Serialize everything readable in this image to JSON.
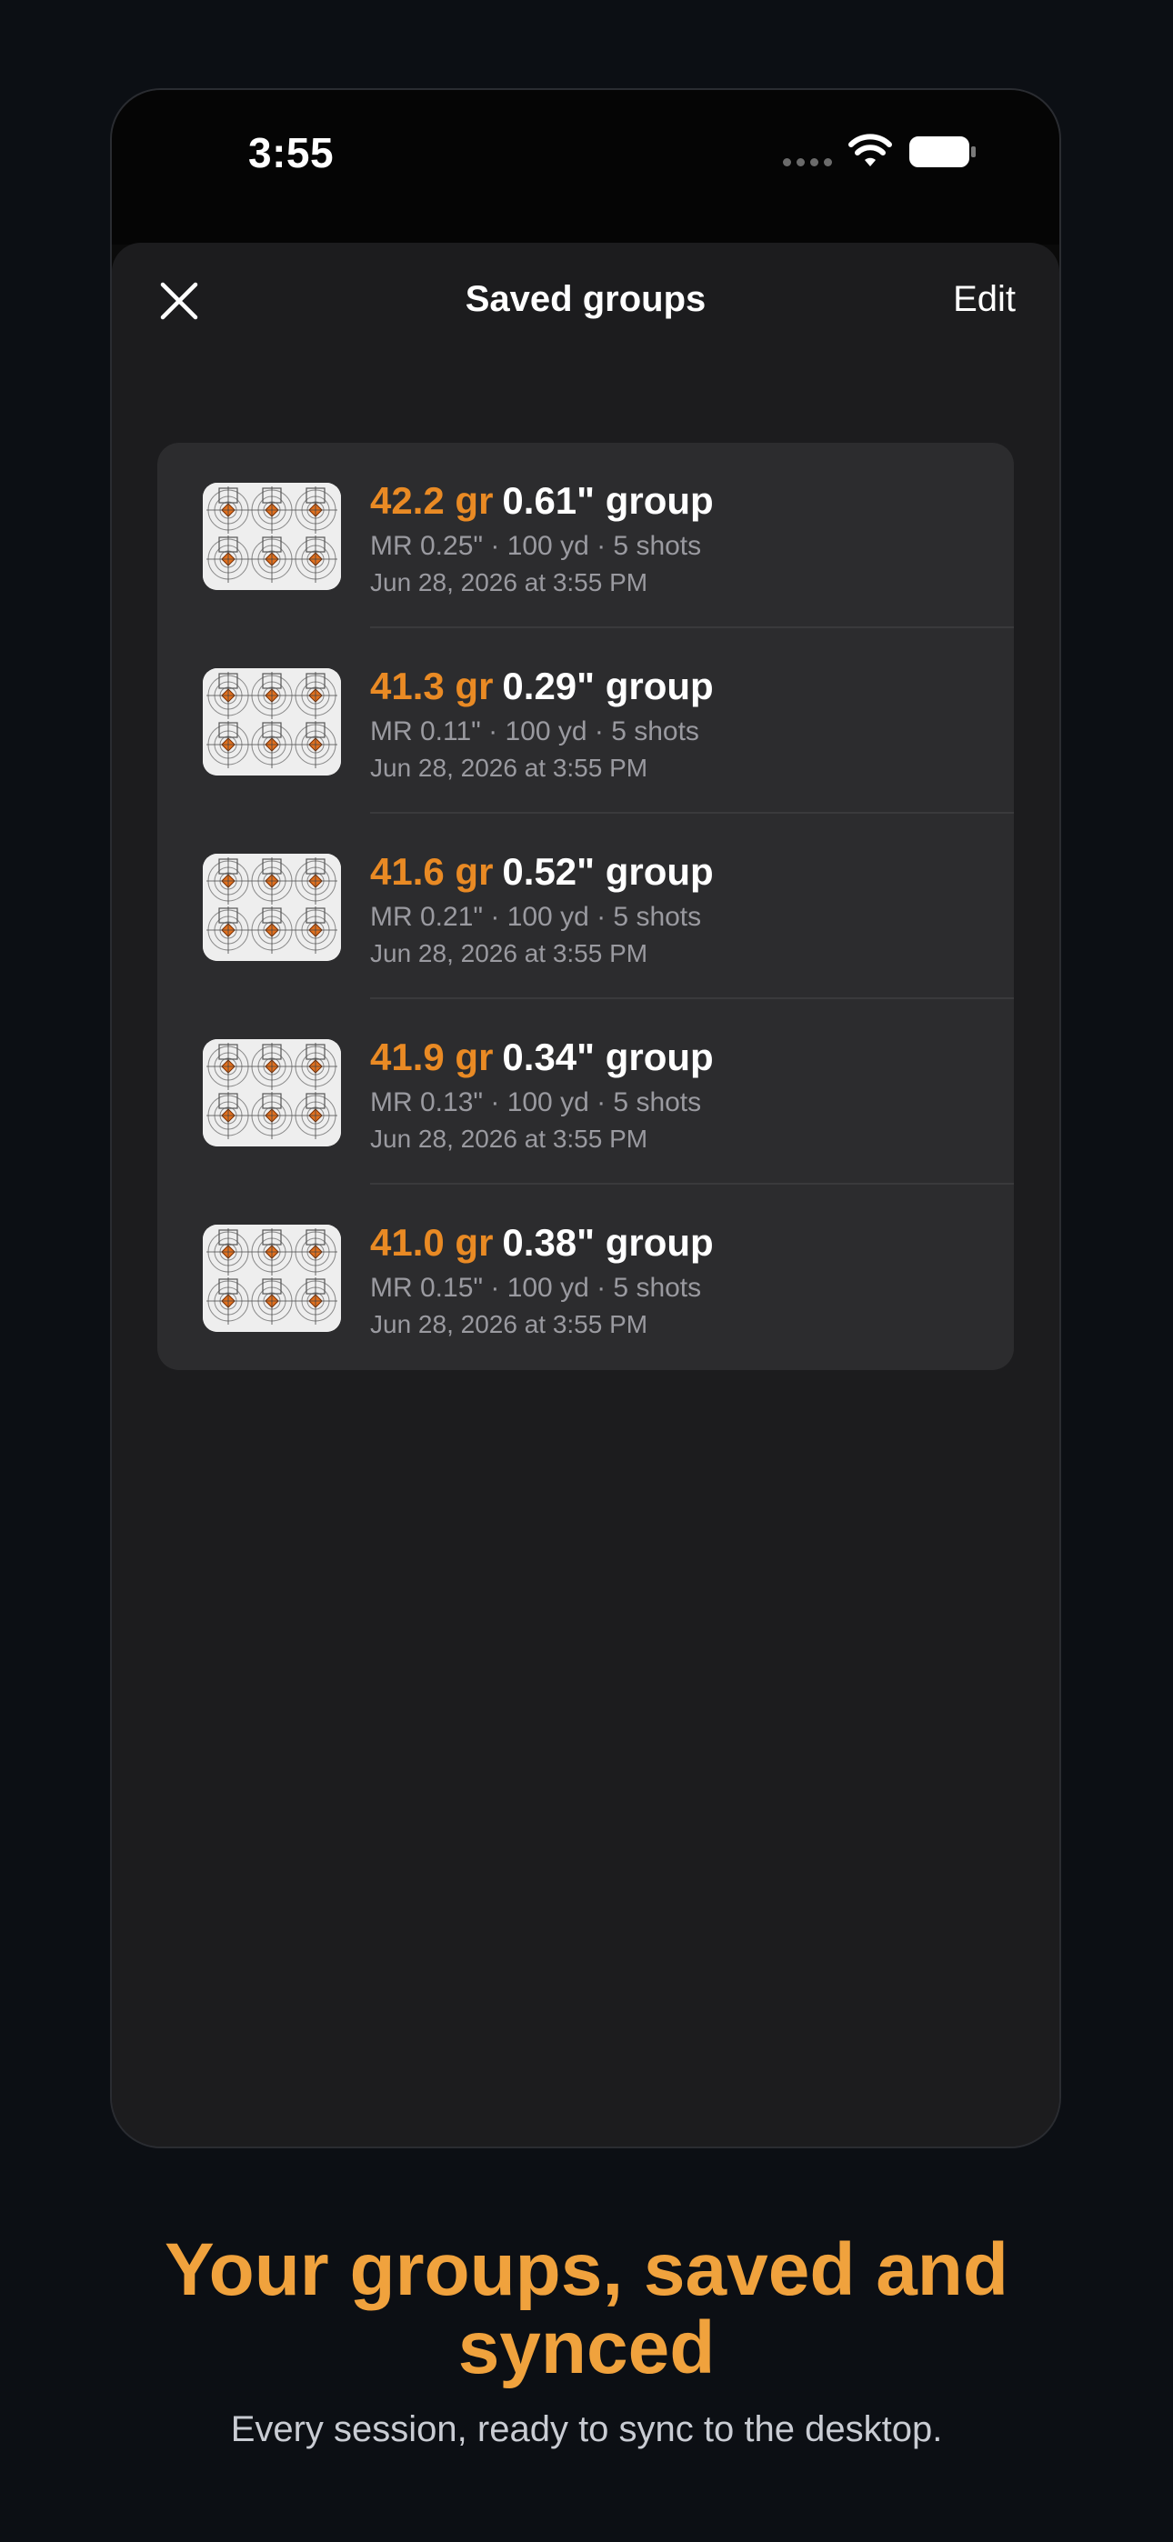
{
  "status_bar": {
    "time": "3:55"
  },
  "sheet": {
    "title": "Saved groups",
    "edit_label": "Edit",
    "close_icon": "close-icon"
  },
  "groups": [
    {
      "charge": "42.2 gr",
      "group": "0.61\" group",
      "meta": "MR 0.25\" · 100 yd · 5 shots",
      "date": "Jun 28, 2026 at 3:55 PM"
    },
    {
      "charge": "41.3 gr",
      "group": "0.29\" group",
      "meta": "MR 0.11\" · 100 yd · 5 shots",
      "date": "Jun 28, 2026 at 3:55 PM"
    },
    {
      "charge": "41.6 gr",
      "group": "0.52\" group",
      "meta": "MR 0.21\" · 100 yd · 5 shots",
      "date": "Jun 28, 2026 at 3:55 PM"
    },
    {
      "charge": "41.9 gr",
      "group": "0.34\" group",
      "meta": "MR 0.13\" · 100 yd · 5 shots",
      "date": "Jun 28, 2026 at 3:55 PM"
    },
    {
      "charge": "41.0 gr",
      "group": "0.38\" group",
      "meta": "MR 0.15\" · 100 yd · 5 shots",
      "date": "Jun 28, 2026 at 3:55 PM"
    }
  ],
  "marketing": {
    "headline": "Your groups, saved and synced",
    "subline": "Every session, ready to sync to the desktop."
  },
  "colors": {
    "accent": "#e98a24",
    "headline": "#f0a23d",
    "background": "#0c0f14",
    "sheet": "#1c1c1e",
    "card": "#2c2c2e"
  }
}
